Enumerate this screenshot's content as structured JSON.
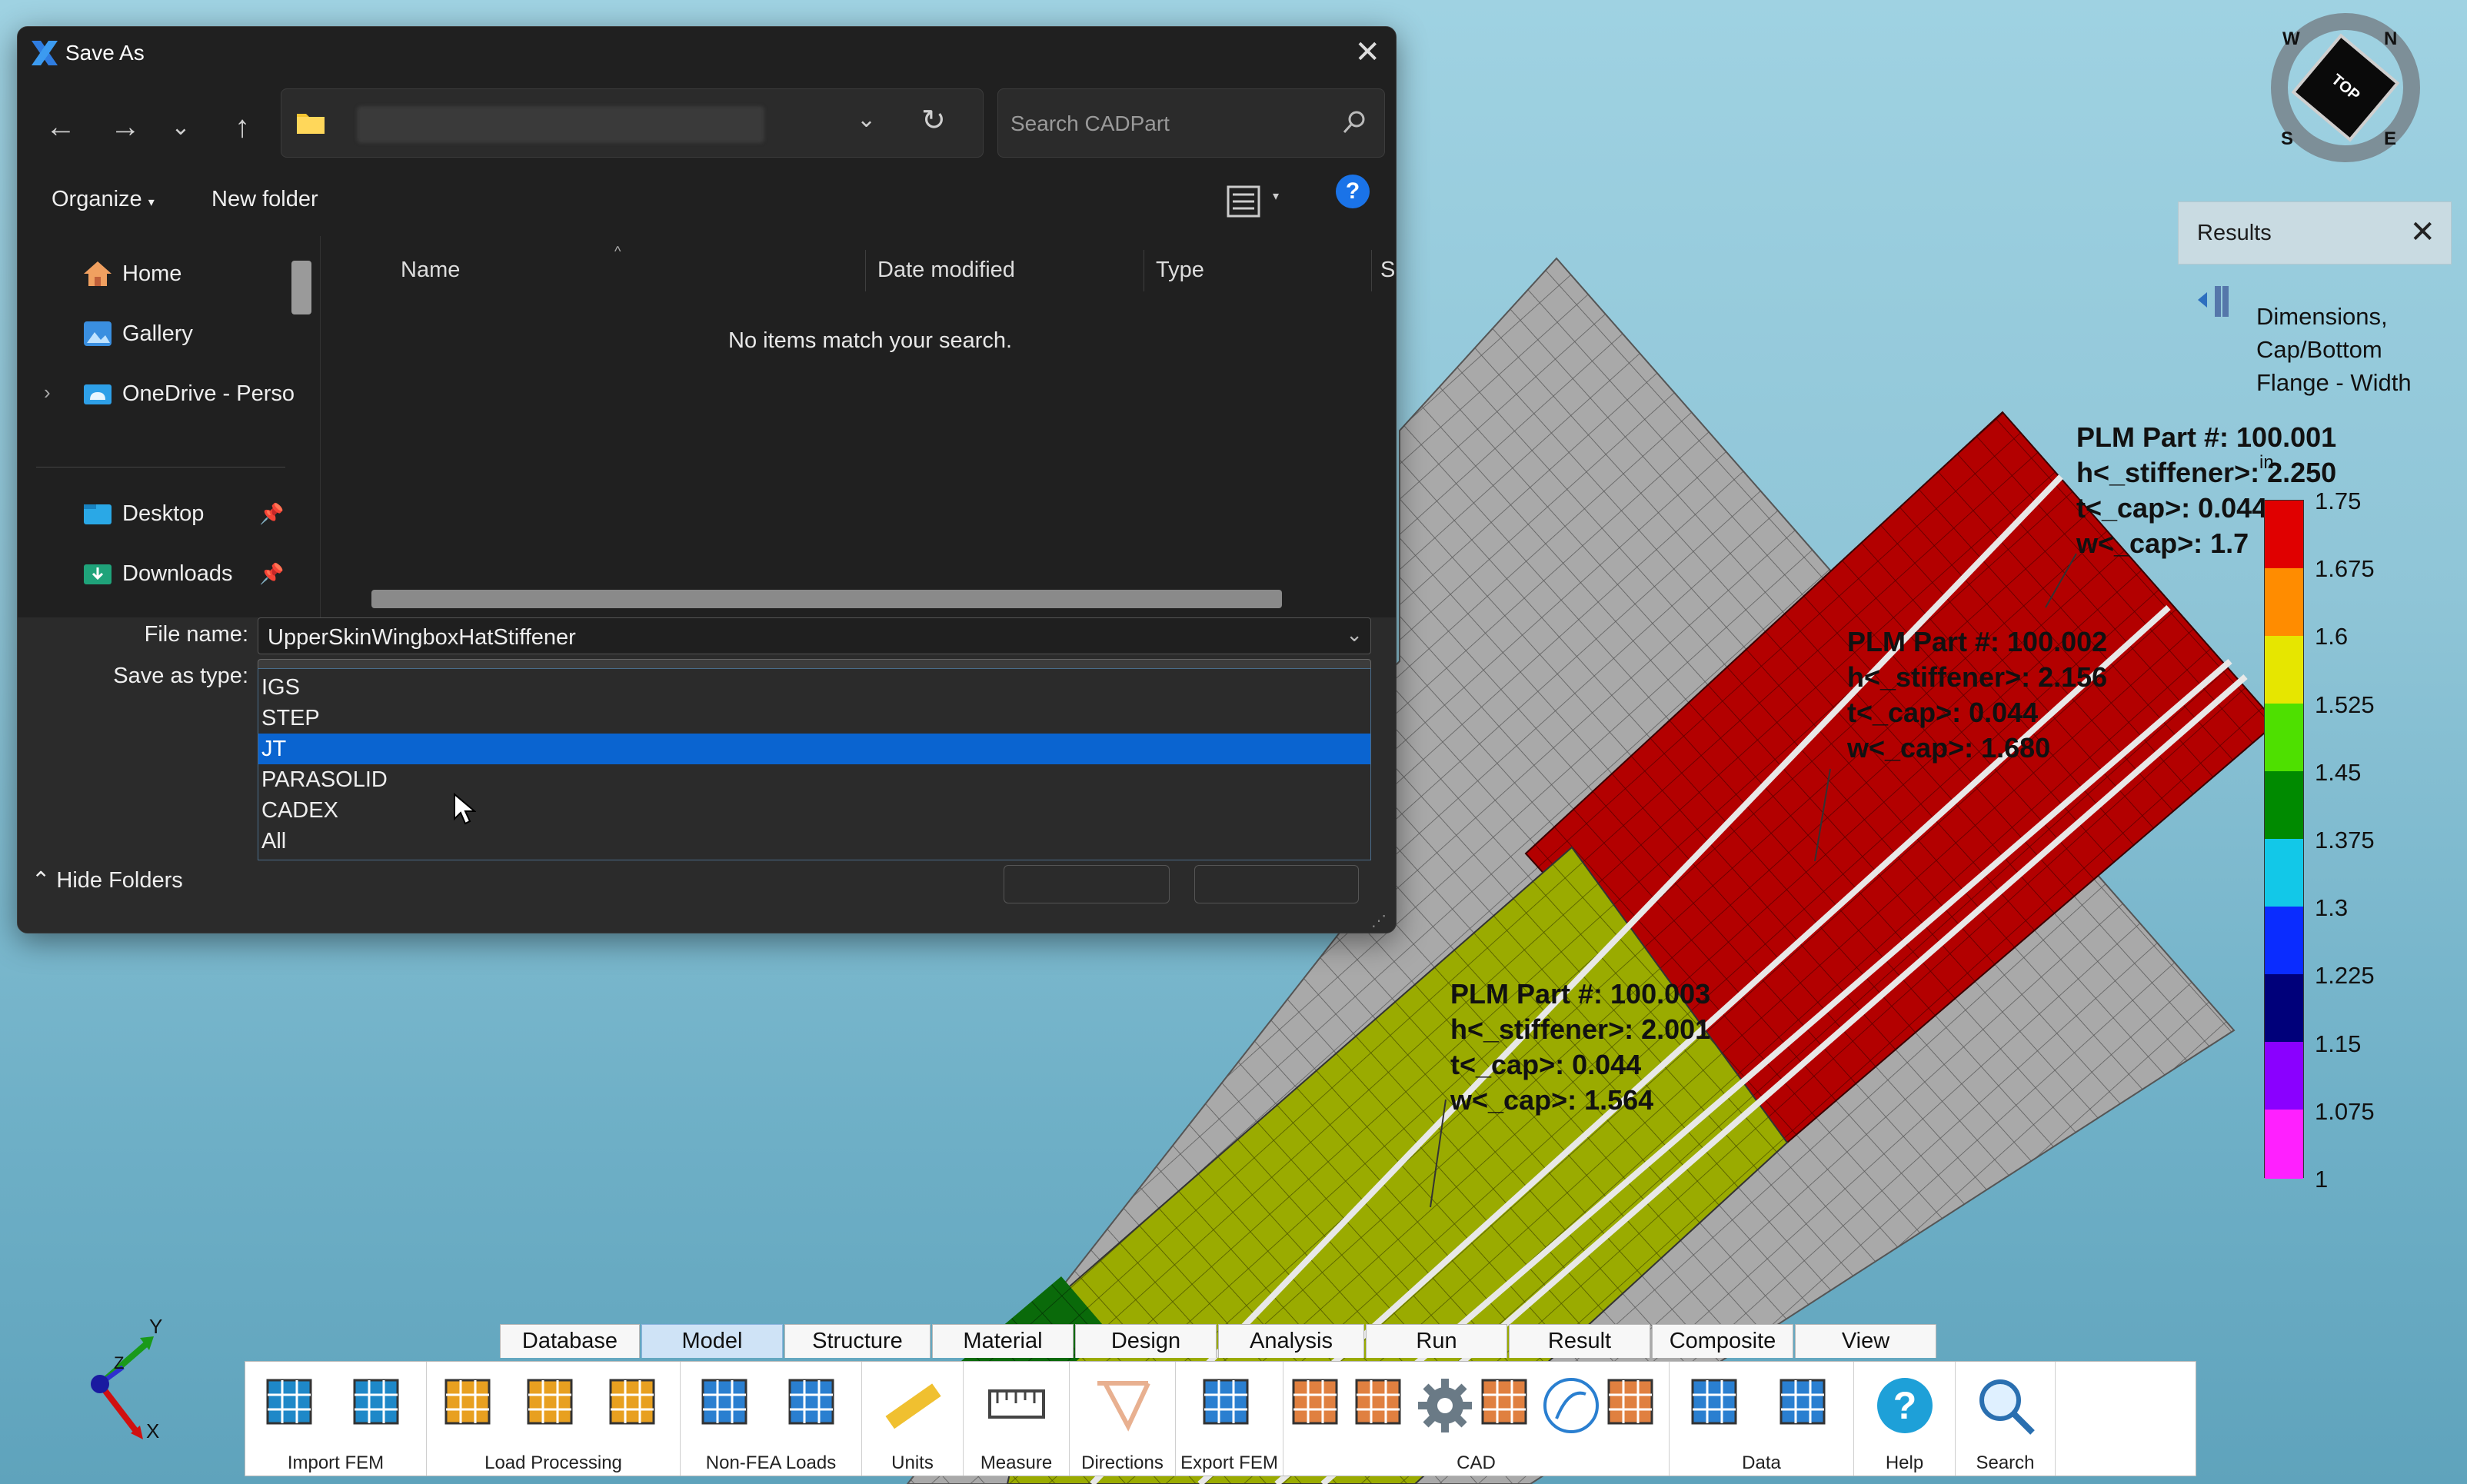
{
  "dialog": {
    "title": "Save As",
    "search_placeholder": "Search CADPart",
    "commands": {
      "organize": "Organize",
      "new_folder": "New folder",
      "help": "?"
    },
    "nav_items": [
      {
        "label": "Home"
      },
      {
        "label": "Gallery"
      },
      {
        "label": "OneDrive - Perso"
      },
      {
        "label": "Desktop"
      },
      {
        "label": "Downloads"
      }
    ],
    "columns": [
      "Name",
      "Date modified",
      "Type",
      "Siz"
    ],
    "empty_message": "No items match your search.",
    "file_name_label": "File name:",
    "file_name_value": "UpperSkinWingboxHatStiffener",
    "save_type_label": "Save as type:",
    "save_type_value": "JT",
    "type_options": [
      "IGS",
      "STEP",
      "JT",
      "PARASOLID",
      "CADEX",
      "All"
    ],
    "selected_option": "JT",
    "hide_folders": "Hide Folders"
  },
  "compass": {
    "top": "TOP",
    "n": "N",
    "e": "E",
    "s": "S",
    "w": "W"
  },
  "results": {
    "title": "Results",
    "dimension_label": "Dimensions, Cap/Bottom Flange - Width",
    "units": "in",
    "legend_ticks": [
      "1.75",
      "1.675",
      "1.6",
      "1.525",
      "1.45",
      "1.375",
      "1.3",
      "1.225",
      "1.15",
      "1.075",
      "1"
    ],
    "legend_colors": [
      "#e00000",
      "#ff8c00",
      "#e6e600",
      "#4ee000",
      "#008a00",
      "#12c8e8",
      "#0a2cff",
      "#00007a",
      "#8a00ff",
      "#ff20ff"
    ]
  },
  "plm_labels": [
    {
      "part": "PLM Part #: 100.001",
      "h": "h<_stiffener>: 2.250",
      "t": "t<_cap>: 0.044",
      "w": "w<_cap>: 1.7"
    },
    {
      "part": "PLM Part #: 100.002",
      "h": "h<_stiffener>: 2.156",
      "t": "t<_cap>: 0.044",
      "w": "w<_cap>: 1.680"
    },
    {
      "part": "PLM Part #: 100.003",
      "h": "h<_stiffener>: 2.001",
      "t": "t<_cap>: 0.044",
      "w": "w<_cap>: 1.564"
    }
  ],
  "triad": {
    "x": "X",
    "y": "Y",
    "z": "Z"
  },
  "ribbon": {
    "tabs": [
      "Database",
      "Model",
      "Structure",
      "Material",
      "Design",
      "Analysis",
      "Run",
      "Result",
      "Composite",
      "View"
    ],
    "active_tab": "Model",
    "groups": [
      "Import FEM",
      "Load Processing",
      "Non-FEA Loads",
      "Units",
      "Measure",
      "Directions",
      "Export FEM",
      "CAD",
      "Data",
      "Help",
      "Search"
    ]
  }
}
